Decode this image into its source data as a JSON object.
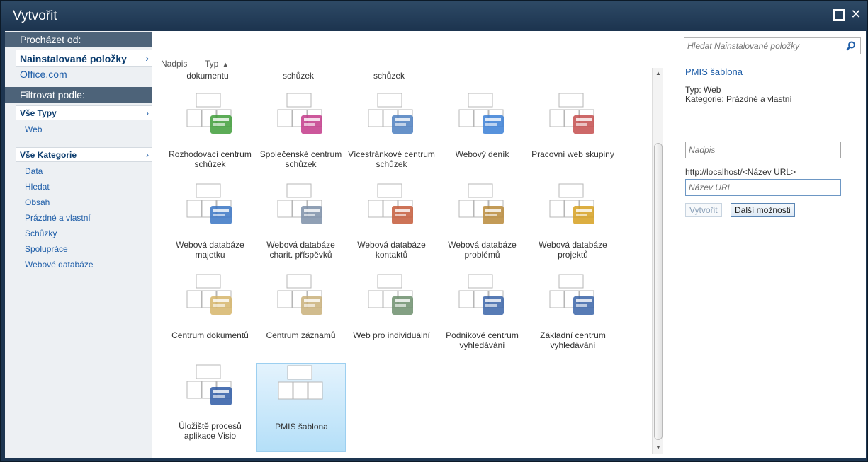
{
  "window": {
    "title": "Vytvořit"
  },
  "left": {
    "browse_header": "Procházet od:",
    "installed": "Nainstalované položky",
    "office": "Office.com",
    "filter_header": "Filtrovat podle:",
    "all_types": "Vše Typy",
    "types": [
      "Web"
    ],
    "all_categories": "Vše Kategorie",
    "categories": [
      "Data",
      "Hledat",
      "Obsah",
      "Prázdné a vlastní",
      "Schůzky",
      "Spolupráce",
      "Webové databáze"
    ]
  },
  "sort": {
    "title": "Nadpis",
    "type": "Typ",
    "type_arrow": "▲"
  },
  "partial_labels": [
    "dokumentu",
    "schůzek",
    "schůzek"
  ],
  "tiles": [
    {
      "label": "Rozhodovací centrum schůzek",
      "icon": "decision-meeting-icon"
    },
    {
      "label": "Společenské centrum schůzek",
      "icon": "social-meeting-icon"
    },
    {
      "label": "Vícestránkové centrum schůzek",
      "icon": "multipage-meeting-icon"
    },
    {
      "label": "Webový deník",
      "icon": "blog-icon"
    },
    {
      "label": "Pracovní web skupiny",
      "icon": "group-work-icon"
    },
    {
      "label": "Webová databáze majetku",
      "icon": "assets-db-icon"
    },
    {
      "label": "Webová databáze charit. příspěvků",
      "icon": "charity-db-icon"
    },
    {
      "label": "Webová databáze kontaktů",
      "icon": "contacts-db-icon"
    },
    {
      "label": "Webová databáze problémů",
      "icon": "issues-db-icon"
    },
    {
      "label": "Webová databáze projektů",
      "icon": "projects-db-icon"
    },
    {
      "label": "Centrum dokumentů",
      "icon": "document-center-icon"
    },
    {
      "label": "Centrum záznamů",
      "icon": "records-center-icon"
    },
    {
      "label": "Web pro individuální",
      "icon": "personal-web-icon"
    },
    {
      "label": "Podnikové centrum vyhledávání",
      "icon": "enterprise-search-icon"
    },
    {
      "label": "Základní centrum vyhledávání",
      "icon": "basic-search-icon"
    },
    {
      "label": "Úložiště procesů aplikace Visio",
      "icon": "visio-process-icon"
    },
    {
      "label": "PMIS šablona",
      "icon": "pmis-template-icon"
    }
  ],
  "right": {
    "search_placeholder": "Hledat Nainstalované položky",
    "detail_title": "PMIS šablona",
    "detail_type": "Typ: Web",
    "detail_category": "Kategorie: Prázdné a vlastní",
    "title_placeholder": "Nadpis",
    "url_prefix": "http://localhost/<Název URL>",
    "url_placeholder": "Název URL",
    "create_button": "Vytvořit",
    "more_button": "Další možnosti"
  },
  "colors": {
    "accent": "#1f5ea8",
    "header": "#4d6379",
    "selected_tile": "#b4dff8"
  }
}
